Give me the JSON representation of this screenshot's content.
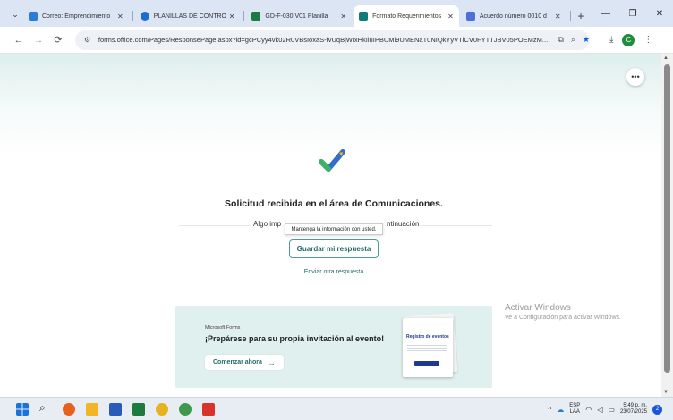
{
  "browser": {
    "tabs": [
      {
        "title": "Correo: Emprendimiento",
        "favicon_color": "#2b7cd3",
        "active": false
      },
      {
        "title": "PLANILLAS DE CONTROL",
        "favicon_color": "#1b6ed0",
        "active": false
      },
      {
        "title": "GD-F-030 V01 Planilla",
        "favicon_color": "#1f7a3f",
        "active": false
      },
      {
        "title": "Formato Requerimientos",
        "favicon_color": "#117a77",
        "active": true
      },
      {
        "title": "Acuerdo número 0010 d",
        "favicon_color": "#4f6ed8",
        "active": false
      }
    ],
    "url": "forms.office.com/Pages/ResponsePage.aspx?id=gcPCyy4vk02R0VBsIoxaS-fvUqBjWIxHkIiuIPBUMi9UMENaT0NIQkYyVTlCV0FYTTJBV05POEMzM...",
    "window_controls": [
      "—",
      "❐",
      "✕"
    ]
  },
  "form": {
    "confirmation_title": "Solicitud recibida en el área de Comunicaciones.",
    "info_text_start": "Algo imp",
    "info_text_end": "ntinuación",
    "tooltip": "Mantenga la información con usted.",
    "save_button": "Guardar mi respuesta",
    "another_response": "Enviar otra respuesta"
  },
  "promo": {
    "brand": "Microsoft Forms",
    "headline": "¡Prepárese para su propia invitación al evento!",
    "cta": "Comenzar ahora",
    "card_title": "Registro de eventos"
  },
  "watermark": {
    "line1": "Activar Windows",
    "line2": "Ve a Configuración para activar Windows."
  },
  "taskbar": {
    "lang_top": "ESP",
    "lang_bottom": "LAA",
    "time": "5:49 p. m.",
    "date": "23/07/2025",
    "notifications": "2"
  },
  "colors": {
    "accent": "#1f6d69",
    "promo_bg": "#e0f0ef"
  }
}
